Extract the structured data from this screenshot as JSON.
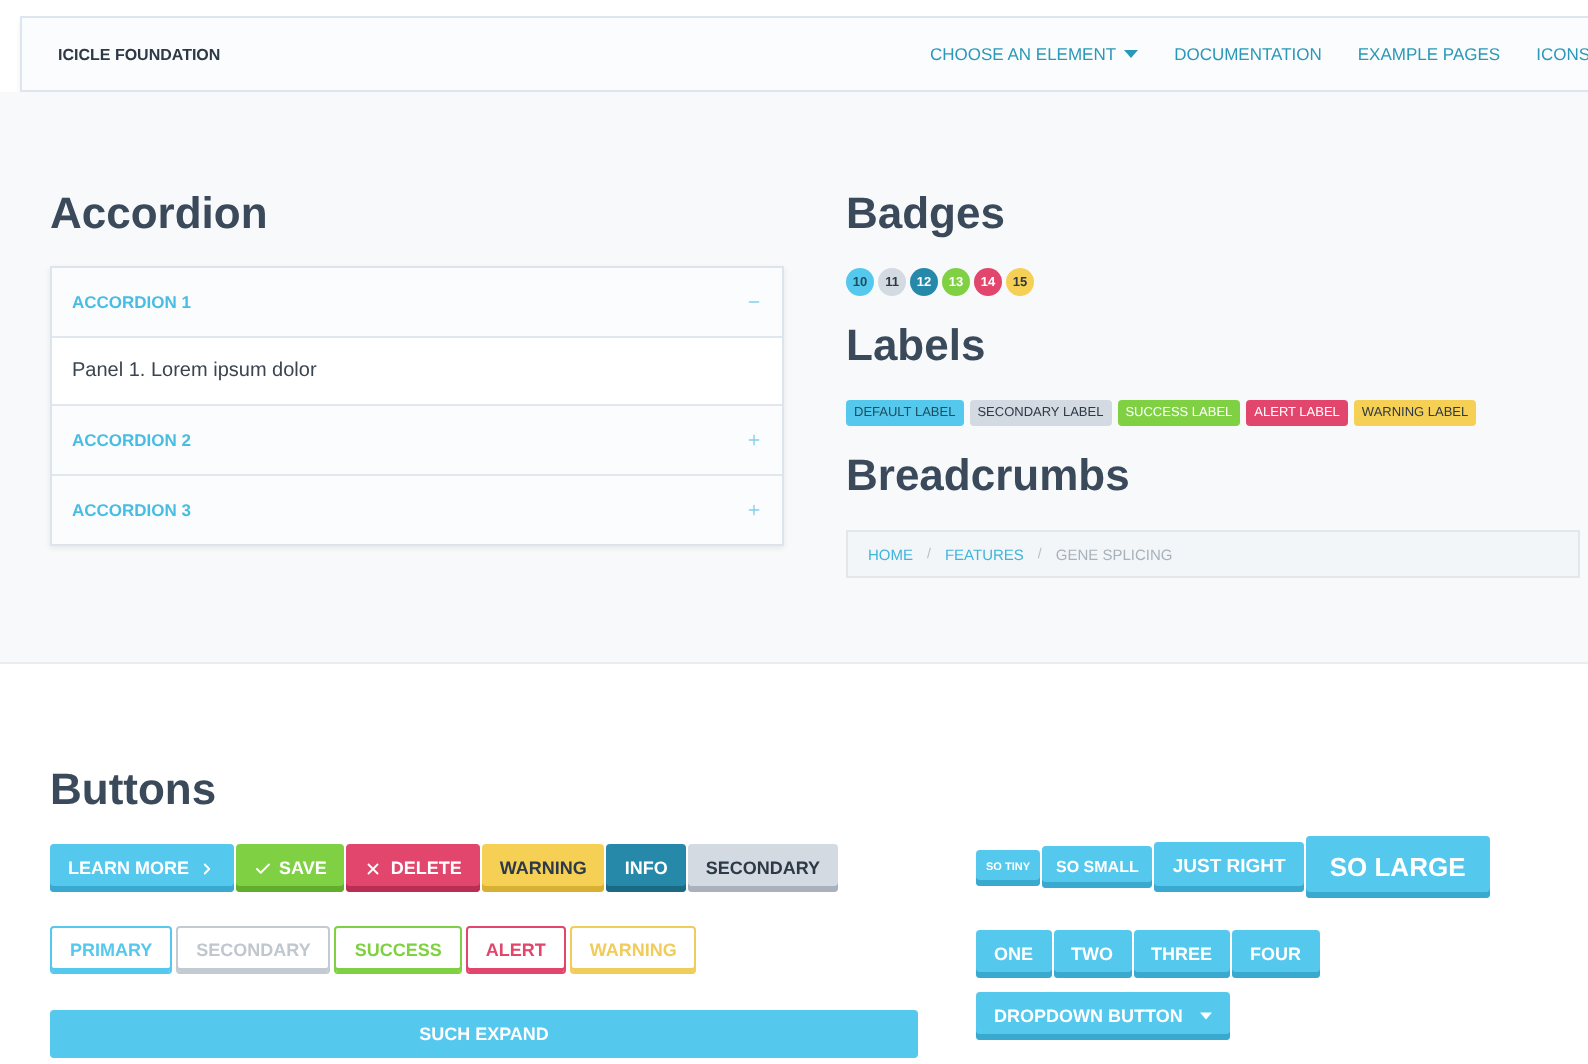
{
  "nav": {
    "brand": "ICICLE FOUNDATION",
    "items": [
      {
        "label": "CHOOSE AN ELEMENT",
        "kind": "dropdown"
      },
      {
        "label": "DOCUMENTATION",
        "kind": "link"
      },
      {
        "label": "EXAMPLE PAGES",
        "kind": "link"
      },
      {
        "label": "ICONS",
        "kind": "link"
      }
    ]
  },
  "accordion": {
    "title": "Accordion",
    "items": [
      {
        "title": "ACCORDION 1",
        "expanded": true,
        "panel": "Panel 1. Lorem ipsum dolor"
      },
      {
        "title": "ACCORDION 2",
        "expanded": false
      },
      {
        "title": "ACCORDION 3",
        "expanded": false
      }
    ]
  },
  "badges": {
    "title": "Badges",
    "items": [
      {
        "text": "10",
        "kind": "primary"
      },
      {
        "text": "11",
        "kind": "secondary"
      },
      {
        "text": "12",
        "kind": "info"
      },
      {
        "text": "13",
        "kind": "success"
      },
      {
        "text": "14",
        "kind": "alert"
      },
      {
        "text": "15",
        "kind": "warning"
      }
    ]
  },
  "labels": {
    "title": "Labels",
    "items": [
      {
        "text": "DEFAULT LABEL",
        "kind": "primary"
      },
      {
        "text": "SECONDARY LABEL",
        "kind": "secondary"
      },
      {
        "text": "SUCCESS LABEL",
        "kind": "success"
      },
      {
        "text": "ALERT LABEL",
        "kind": "alert"
      },
      {
        "text": "WARNING LABEL",
        "kind": "warning"
      }
    ]
  },
  "breadcrumbs": {
    "title": "Breadcrumbs",
    "separator": "/",
    "items": [
      {
        "label": "HOME",
        "current": false
      },
      {
        "label": "FEATURES",
        "current": false
      },
      {
        "label": "GENE SPLICING",
        "current": true
      }
    ]
  },
  "buttons": {
    "title": "Buttons",
    "solid": [
      {
        "label": "LEARN MORE",
        "kind": "primary"
      },
      {
        "label": "SAVE",
        "kind": "success"
      },
      {
        "label": "DELETE",
        "kind": "alert"
      },
      {
        "label": "WARNING",
        "kind": "warning"
      },
      {
        "label": "INFO",
        "kind": "info"
      },
      {
        "label": "SECONDARY",
        "kind": "secondary"
      }
    ],
    "hollow": [
      {
        "label": "PRIMARY",
        "kind": "primary"
      },
      {
        "label": "SECONDARY",
        "kind": "secondary"
      },
      {
        "label": "SUCCESS",
        "kind": "success"
      },
      {
        "label": "ALERT",
        "kind": "alert"
      },
      {
        "label": "WARNING",
        "kind": "warning"
      }
    ],
    "expand": {
      "label": "SUCH EXPAND"
    },
    "sizes": [
      {
        "label": "SO TINY",
        "kind": "tiny"
      },
      {
        "label": "SO SMALL",
        "kind": "small"
      },
      {
        "label": "JUST RIGHT",
        "kind": "medium"
      },
      {
        "label": "SO LARGE",
        "kind": "large"
      }
    ],
    "group": [
      {
        "label": "ONE"
      },
      {
        "label": "TWO"
      },
      {
        "label": "THREE"
      },
      {
        "label": "FOUR"
      }
    ],
    "dropdown": {
      "label": "DROPDOWN BUTTON"
    }
  }
}
